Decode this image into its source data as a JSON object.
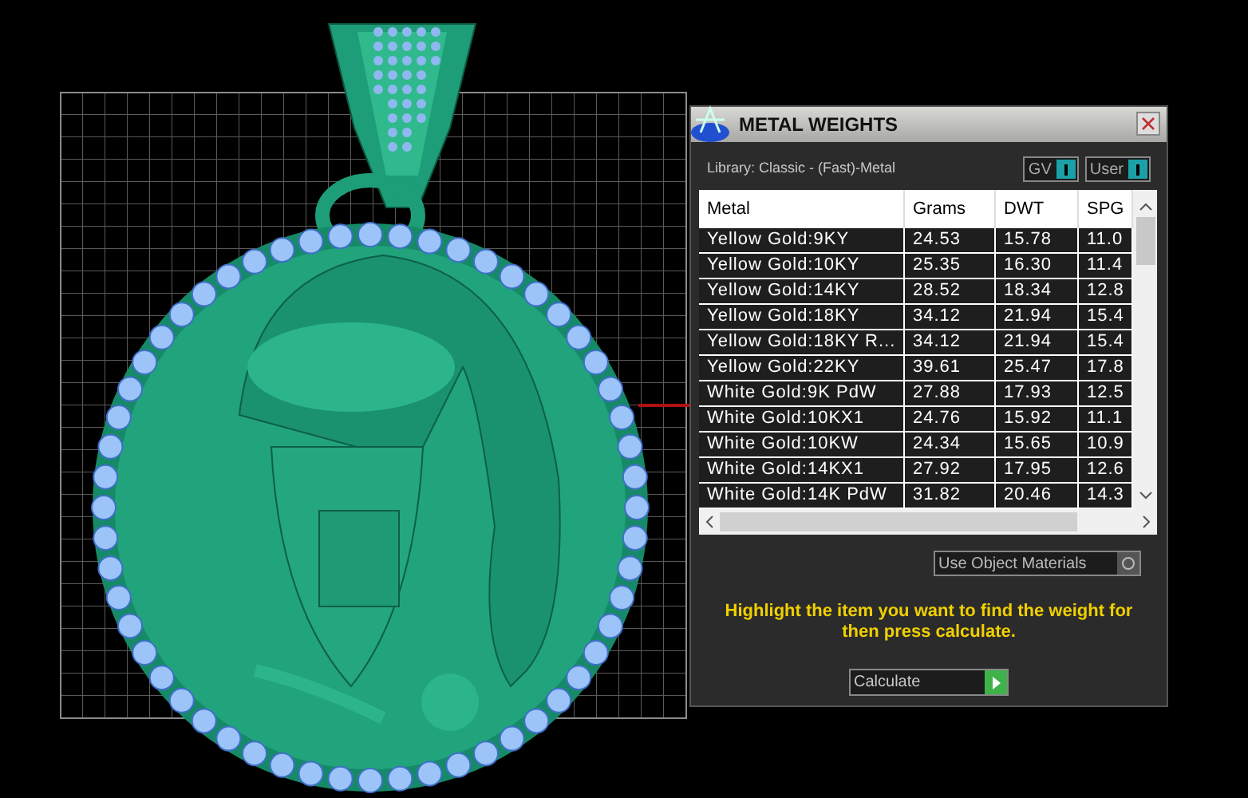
{
  "dialog": {
    "title": "METAL WEIGHTS",
    "library": "Library: Classic - (Fast)-Metal",
    "toggles": [
      {
        "label": "GV",
        "on": true
      },
      {
        "label": "User",
        "on": true
      }
    ],
    "table": {
      "columns": [
        "Metal",
        "Grams",
        "DWT",
        "SPG"
      ],
      "rows": [
        [
          "Yellow Gold:9KY",
          "24.53",
          "15.78",
          "11.0"
        ],
        [
          "Yellow Gold:10KY",
          "25.35",
          "16.30",
          "11.4"
        ],
        [
          "Yellow Gold:14KY",
          "28.52",
          "18.34",
          "12.8"
        ],
        [
          "Yellow Gold:18KY",
          "34.12",
          "21.94",
          "15.4"
        ],
        [
          "Yellow Gold:18KY R...",
          "34.12",
          "21.94",
          "15.4"
        ],
        [
          "Yellow Gold:22KY",
          "39.61",
          "25.47",
          "17.8"
        ],
        [
          "White Gold:9K PdW",
          "27.88",
          "17.93",
          "12.5"
        ],
        [
          "White Gold:10KX1",
          "24.76",
          "15.92",
          "11.1"
        ],
        [
          "White Gold:10KW",
          "24.34",
          "15.65",
          "10.9"
        ],
        [
          "White Gold:14KX1",
          "27.92",
          "17.95",
          "12.6"
        ],
        [
          "White Gold:14K PdW",
          "31.82",
          "20.46",
          "14.3"
        ]
      ]
    },
    "use_object_materials": {
      "label": "Use Object Materials",
      "on": false
    },
    "hint": "Highlight the item you want to find the weight for then press calculate.",
    "calculate_button": "Calculate"
  }
}
